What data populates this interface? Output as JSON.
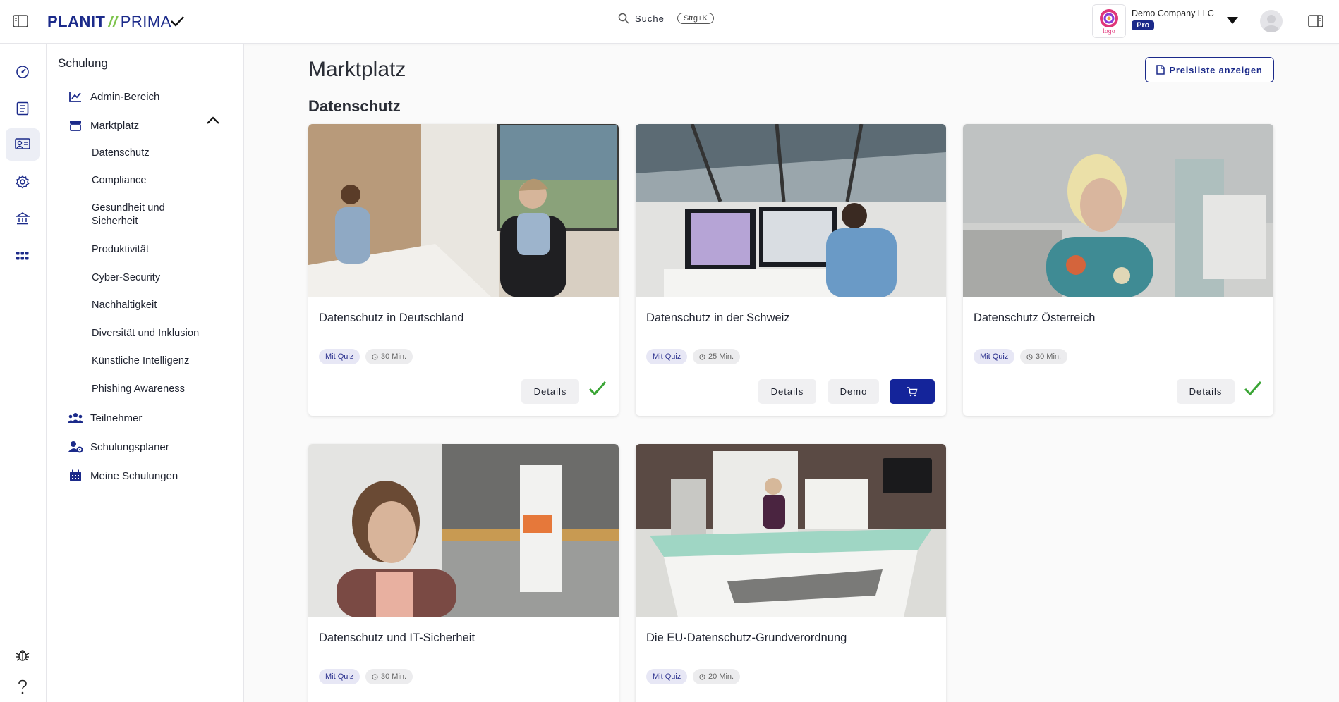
{
  "brand": {
    "part1": "PLANIT",
    "slash": "//",
    "part2": "PRIMA"
  },
  "search": {
    "label": "Suche",
    "shortcut": "Strg+K"
  },
  "account": {
    "company": "Demo Company LLC",
    "plan": "Pro",
    "logo_text": "logo"
  },
  "sidebar": {
    "title": "Schulung",
    "admin": "Admin-Bereich",
    "marketplace": "Marktplatz",
    "categories": [
      "Datenschutz",
      "Compliance",
      "Gesundheit und Sicherheit",
      "Produktivität",
      "Cyber-Security",
      "Nachhaltigkeit",
      "Diversität und Inklusion",
      "Künstliche Intelligenz",
      "Phishing Awareness"
    ],
    "participants": "Teilnehmer",
    "planner": "Schulungsplaner",
    "my_trainings": "Meine Schulungen"
  },
  "main": {
    "title": "Marktplatz",
    "price_list_button": "Preisliste anzeigen",
    "section": "Datenschutz"
  },
  "courses": [
    {
      "title": "Datenschutz in Deutschland",
      "quiz": "Mit Quiz",
      "duration": "30 Min.",
      "details": "Details",
      "owned": true
    },
    {
      "title": "Datenschutz in der Schweiz",
      "quiz": "Mit Quiz",
      "duration": "25 Min.",
      "details": "Details",
      "demo": "Demo",
      "owned": false
    },
    {
      "title": "Datenschutz Österreich",
      "quiz": "Mit Quiz",
      "duration": "30 Min.",
      "details": "Details",
      "owned": true
    },
    {
      "title": "Datenschutz und IT-Sicherheit",
      "quiz": "Mit Quiz",
      "duration": "30 Min."
    },
    {
      "title": "Die EU-Datenschutz-Grundverordnung",
      "quiz": "Mit Quiz",
      "duration": "20 Min."
    }
  ],
  "colors": {
    "brand_blue": "#1b2a8a",
    "cart_button": "#14249a",
    "check_green": "#3aa535",
    "slash_green": "#7cc34a"
  }
}
